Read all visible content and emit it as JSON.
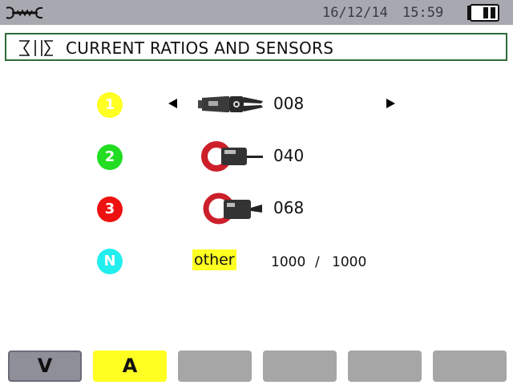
{
  "status_bar": {
    "date": "16/12/14",
    "time": "15:59",
    "tools_icon": "wrench-settings-icon",
    "battery_icon": "battery-icon"
  },
  "header": {
    "icon": "current-sensor-icon",
    "title": "CURRENT RATIOS AND SENSORS"
  },
  "sensors": [
    {
      "channel": "1",
      "color": "#ffff22",
      "sensor_icon": "flex-clamp-icon",
      "code": "008",
      "selected": true
    },
    {
      "channel": "2",
      "color": "#22dd22",
      "sensor_icon": "clamp-icon",
      "code": "040"
    },
    {
      "channel": "3",
      "color": "#ee1111",
      "sensor_icon": "clamp-icon",
      "code": "068"
    },
    {
      "channel": "N",
      "color": "#22eeee",
      "sensor_label": "other",
      "ratio_primary": "1000",
      "ratio_separator": "/",
      "ratio_secondary": "1000"
    }
  ],
  "softkeys": [
    {
      "label": "V",
      "state": "normal"
    },
    {
      "label": "A",
      "state": "active",
      "color": "#ffff22"
    },
    {
      "label": ""
    },
    {
      "label": ""
    },
    {
      "label": ""
    },
    {
      "label": ""
    }
  ]
}
